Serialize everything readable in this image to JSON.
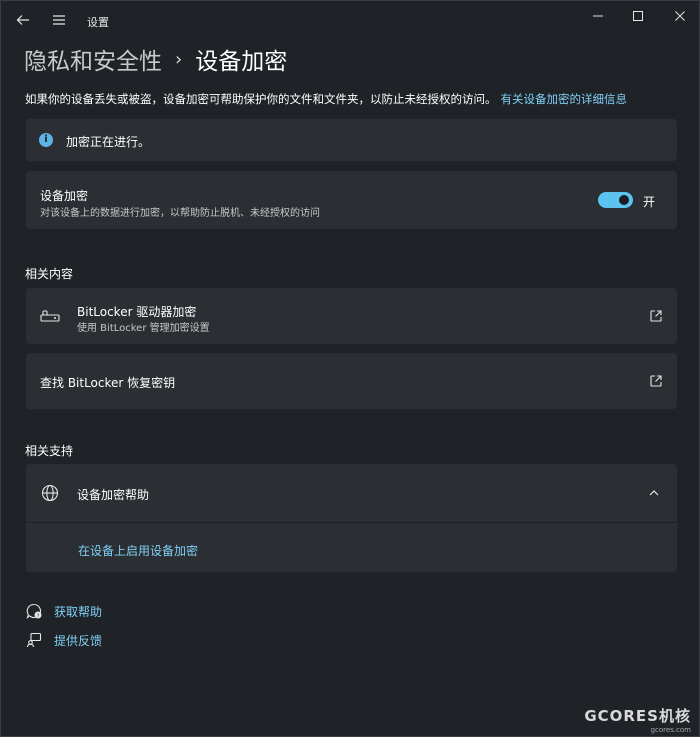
{
  "window": {
    "app_title": "设置"
  },
  "breadcrumb": {
    "parent": "隐私和安全性",
    "separator": "›",
    "current": "设备加密"
  },
  "description": {
    "text": "如果你的设备丢失或被盗，设备加密可帮助保护你的文件和文件夹，以防止未经授权的访问。",
    "link": "有关设备加密的详细信息"
  },
  "info_banner": {
    "text": "加密正在进行。"
  },
  "device_encryption": {
    "title": "设备加密",
    "subtitle": "对该设备上的数据进行加密，以帮助防止脱机、未经授权的访问",
    "toggle_state": "开",
    "toggle_on": true
  },
  "related_content": {
    "heading": "相关内容",
    "bitlocker": {
      "title": "BitLocker 驱动器加密",
      "subtitle": "使用 BitLocker 管理加密设置"
    },
    "recovery": {
      "title": "查找 BitLocker 恢复密钥"
    }
  },
  "related_support": {
    "heading": "相关支持",
    "help_title": "设备加密帮助",
    "help_link": "在设备上启用设备加密"
  },
  "footer": {
    "get_help": "获取帮助",
    "feedback": "提供反馈"
  },
  "watermark": {
    "brand": "GCORES机核",
    "domain": "gcores.com"
  },
  "colors": {
    "background": "#202327",
    "card": "#2b2e33",
    "accent": "#5cc2ef",
    "link": "#7fd0f5"
  }
}
